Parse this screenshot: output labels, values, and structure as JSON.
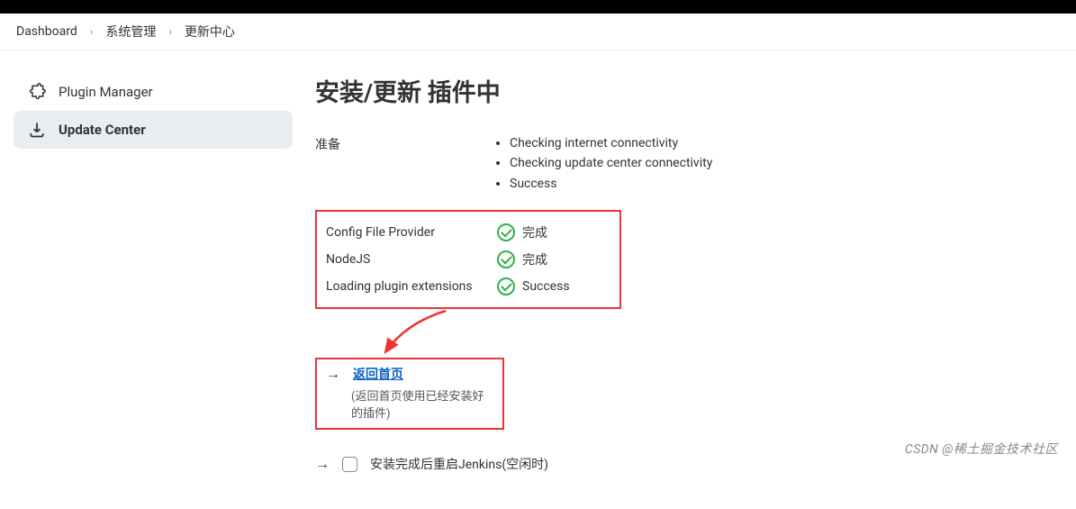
{
  "breadcrumb": {
    "items": [
      "Dashboard",
      "系统管理",
      "更新中心"
    ]
  },
  "sidebar": {
    "items": [
      {
        "label": "Plugin Manager",
        "icon": "puzzle-icon",
        "active": false
      },
      {
        "label": "Update Center",
        "icon": "download-icon",
        "active": true
      }
    ]
  },
  "main": {
    "title": "安装/更新 插件中",
    "prepare_label": "准备",
    "prepare_items": [
      "Checking internet connectivity",
      "Checking update center connectivity",
      "Success"
    ],
    "plugins": [
      {
        "name": "Config File Provider",
        "status": "完成"
      },
      {
        "name": "NodeJS",
        "status": "完成"
      },
      {
        "name": "Loading plugin extensions",
        "status": "Success"
      }
    ],
    "back_link": "返回首页",
    "back_hint": "(返回首页使用已经安装好的插件)",
    "restart_label": "安装完成后重启Jenkins(空闲时)"
  },
  "watermark": "CSDN @稀土掘金技术社区"
}
